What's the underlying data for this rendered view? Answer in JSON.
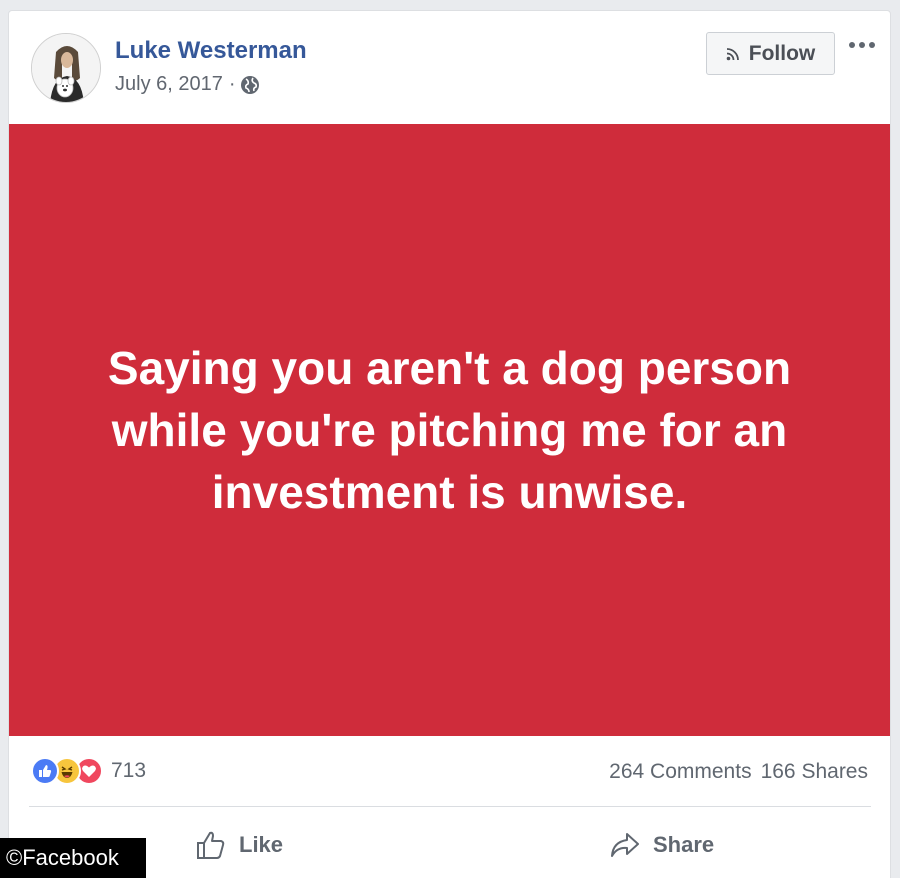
{
  "post": {
    "author_name": "Luke Westerman",
    "date": "July 6, 2017",
    "separator": "·",
    "follow_label": "Follow",
    "body_text": "Saying you aren't a dog person while you're pitching me for an investment is unwise.",
    "background_color": "#cf2c3b",
    "icons": {
      "privacy": "globe-icon",
      "follow": "rss-icon",
      "more": "more-options-icon"
    }
  },
  "stats": {
    "reactions": [
      "like-reaction-icon",
      "haha-reaction-icon",
      "love-reaction-icon"
    ],
    "reaction_count": "713",
    "comments": "264 Comments",
    "shares": "166 Shares"
  },
  "actions": {
    "like_label": "Like",
    "share_label": "Share"
  },
  "watermark": {
    "text": "©Facebook"
  },
  "colors": {
    "link_blue": "#365899",
    "like_blue": "#4b7bf5",
    "haha_yellow": "#f7c53d",
    "love_red": "#f0475e"
  }
}
